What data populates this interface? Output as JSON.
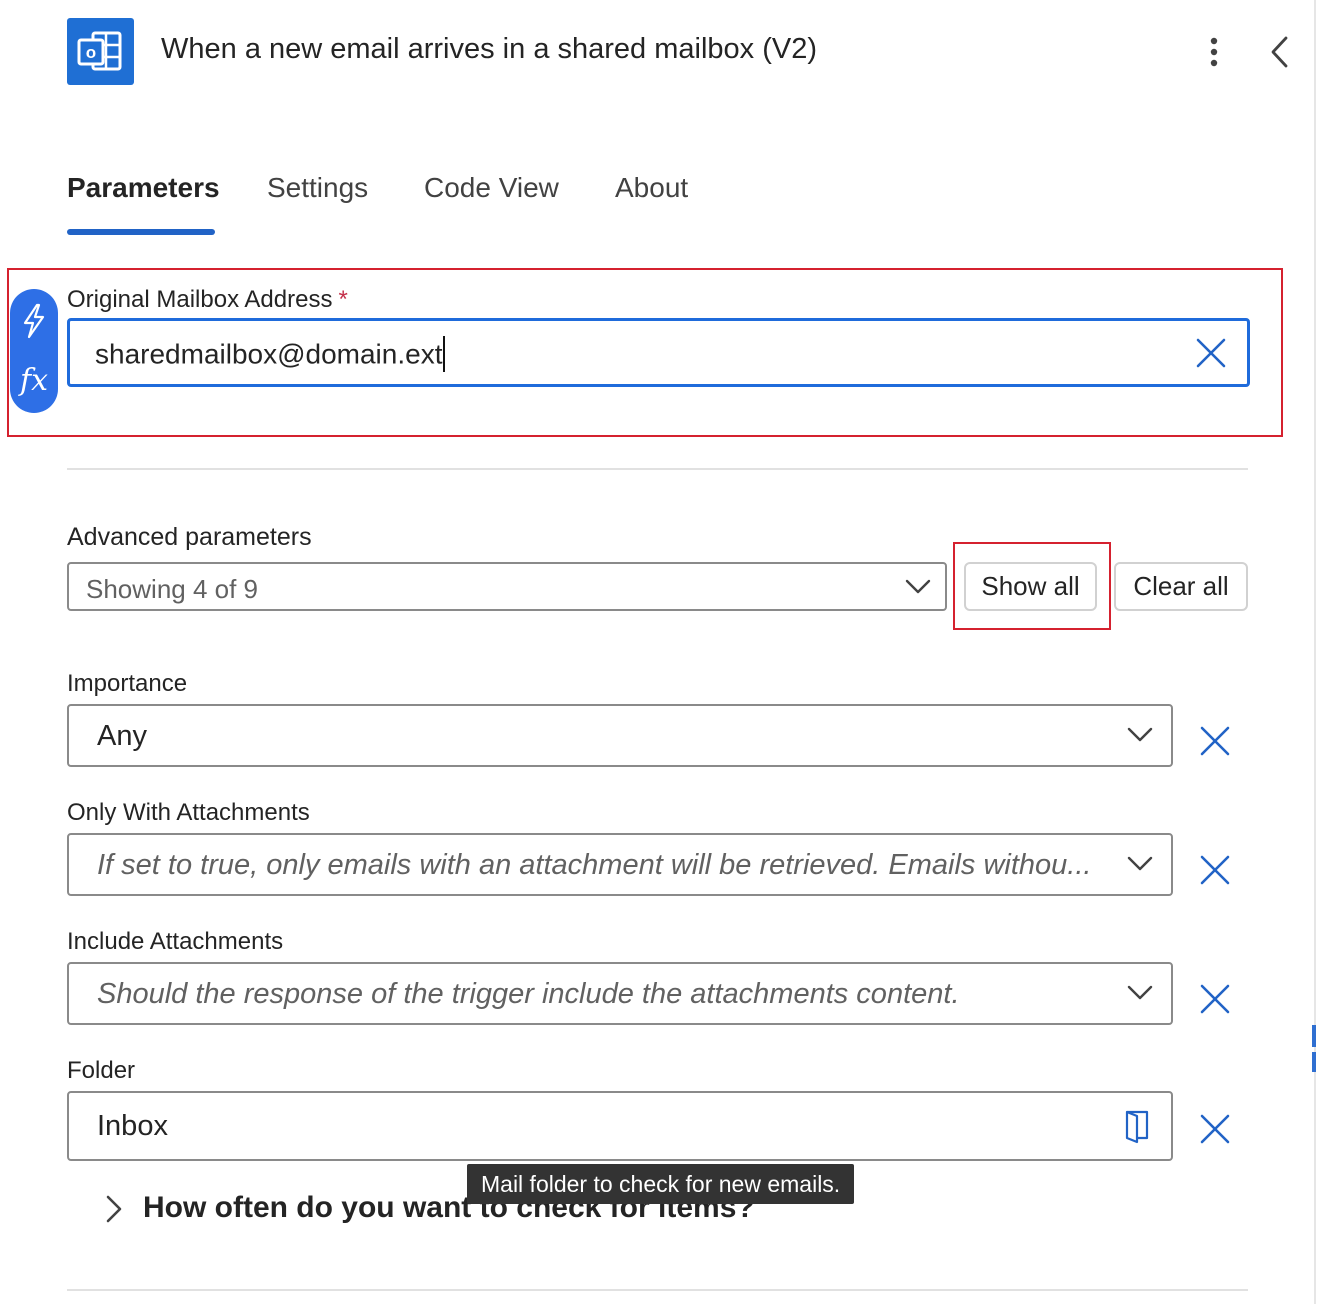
{
  "header": {
    "title": "When a new email arrives in a shared mailbox (V2)",
    "app_icon": "outlook-icon",
    "more_icon": "more-vertical-icon",
    "collapse_icon": "chevron-left-icon"
  },
  "tabs": [
    {
      "label": "Parameters",
      "active": true
    },
    {
      "label": "Settings",
      "active": false
    },
    {
      "label": "Code View",
      "active": false
    },
    {
      "label": "About",
      "active": false
    }
  ],
  "mailbox": {
    "label": "Original Mailbox Address",
    "required_mark": "*",
    "value": "sharedmailbox@domain.ext",
    "token_icons": [
      "lightning-icon",
      "fx-icon"
    ]
  },
  "advanced": {
    "label": "Advanced parameters",
    "selected": "Showing 4 of 9",
    "show_all": "Show all",
    "clear_all": "Clear all"
  },
  "params": [
    {
      "label": "Importance",
      "value": "Any",
      "placeholder": ""
    },
    {
      "label": "Only With Attachments",
      "value": "",
      "placeholder": "If set to true, only emails with an attachment will be retrieved. Emails withou..."
    },
    {
      "label": "Include Attachments",
      "value": "",
      "placeholder": "Should the response of the trigger include the attachments content."
    },
    {
      "label": "Folder",
      "value": "Inbox",
      "placeholder": ""
    }
  ],
  "recurrence": {
    "label": "How often do you want to check for items?"
  },
  "tooltip": {
    "text": "Mail folder to check for new emails."
  },
  "colors": {
    "accent": "#2163c6",
    "highlight": "#d5212f",
    "token_picker": "#2e6fe6",
    "remove_icon": "#2163c6"
  }
}
